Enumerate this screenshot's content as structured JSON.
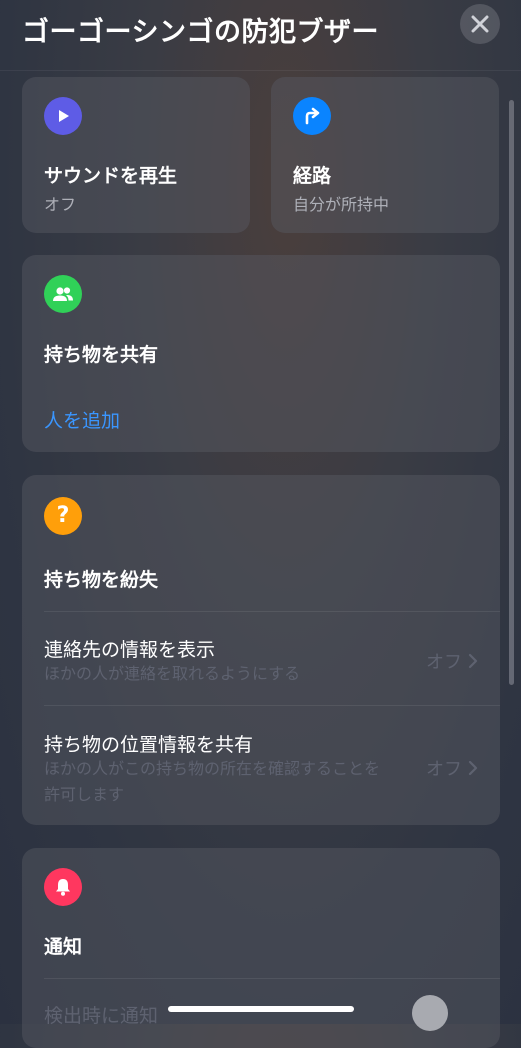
{
  "header": {
    "title": "ゴーゴーシンゴの防犯ブザー",
    "close_icon": "close-icon"
  },
  "play_sound": {
    "icon": "play-icon",
    "icon_color": "#5e5ce6",
    "title": "サウンドを再生",
    "status": "オフ"
  },
  "directions": {
    "icon": "turn-right-arrow-icon",
    "icon_color": "#0a84ff",
    "title": "経路",
    "status": "自分が所持中"
  },
  "share_item": {
    "icon": "people-icon",
    "icon_color": "#30d158",
    "title": "持ち物を共有",
    "add_person": "人を追加"
  },
  "lost_mode": {
    "icon": "question-mark-icon",
    "icon_color": "#ff9f0a",
    "title": "持ち物を紛失",
    "rows": [
      {
        "title": "連絡先の情報を表示",
        "subtitle": "ほかの人が連絡を取れるようにする",
        "value": "オフ"
      },
      {
        "title": "持ち物の位置情報を共有",
        "subtitle": "ほかの人がこの持ち物の所在を確認することを許可します",
        "value": "オフ"
      }
    ]
  },
  "notifications": {
    "icon": "bell-icon",
    "icon_color": "#ff375f",
    "title": "通知",
    "rows": [
      {
        "title": "検出時に通知"
      }
    ]
  }
}
